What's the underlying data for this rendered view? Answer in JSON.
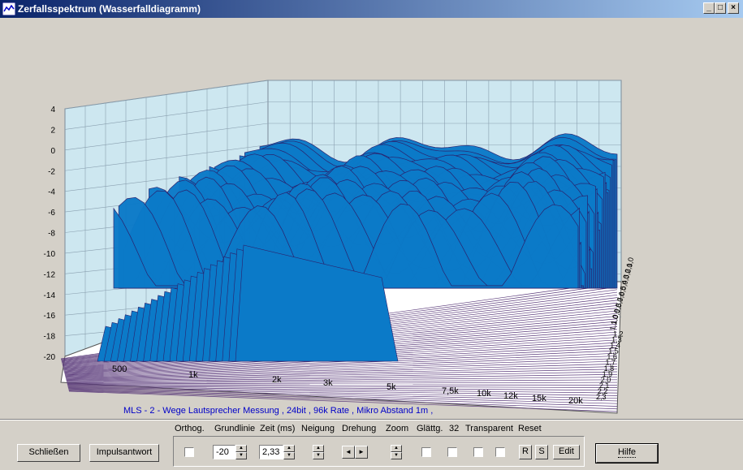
{
  "window": {
    "title": "Zerfallsspektrum  (Wasserfalldiagramm)",
    "min": "_",
    "max": "□",
    "close": "×"
  },
  "chart_data": {
    "type": "area",
    "subtype": "waterfall-3d",
    "y_ticks": [
      "4",
      "2",
      "0",
      "-2",
      "-4",
      "-6",
      "-8",
      "-10",
      "-12",
      "-14",
      "-16",
      "-18",
      "-20"
    ],
    "ylim": [
      -20,
      4
    ],
    "x_ticks": [
      "500",
      "1k",
      "2k",
      "3k",
      "5k",
      "7,5k",
      "10k",
      "12k",
      "15k",
      "20k"
    ],
    "z_ticks": [
      "0,0",
      "0,1",
      "0,2",
      "0,3",
      "0,4",
      "0,5",
      "0,6",
      "0,7",
      "0,8",
      "0,9",
      "1,0",
      "1,1",
      "1,2",
      "1,3",
      "1,4",
      "1,5",
      "1,6",
      "1,7",
      "1,8",
      "1,9",
      "2,0",
      "2,1",
      "2,2",
      "2,3"
    ],
    "grid": true,
    "fill_color": "#0b7ac8",
    "line_color": "#2c1f6b",
    "wall_color": "#cde7f0",
    "floor_line_color": "#5a3a7a"
  },
  "caption": "MLS -  2 - Wege Lautsprecher Messung  , 24bit , 96k Rate , Mikro Abstand 1m ,",
  "controls": {
    "labels": {
      "orthog": "Orthog.",
      "grundlinie": "Grundlinie",
      "zeit": "Zeit (ms)",
      "neigung": "Neigung",
      "drehung": "Drehung",
      "zoom": "Zoom",
      "glaettg": "Glättg.",
      "count": "32",
      "transparent": "Transparent",
      "reset": "Reset"
    },
    "grundlinie_value": "-20",
    "zeit_value": "2,33",
    "left_arrow": "◄",
    "right_arrow": "►",
    "r": "R",
    "s": "S",
    "edit": "Edit"
  },
  "buttons": {
    "close": "Schließen",
    "impulse": "Impulsantwort",
    "help": "Hilfe"
  }
}
